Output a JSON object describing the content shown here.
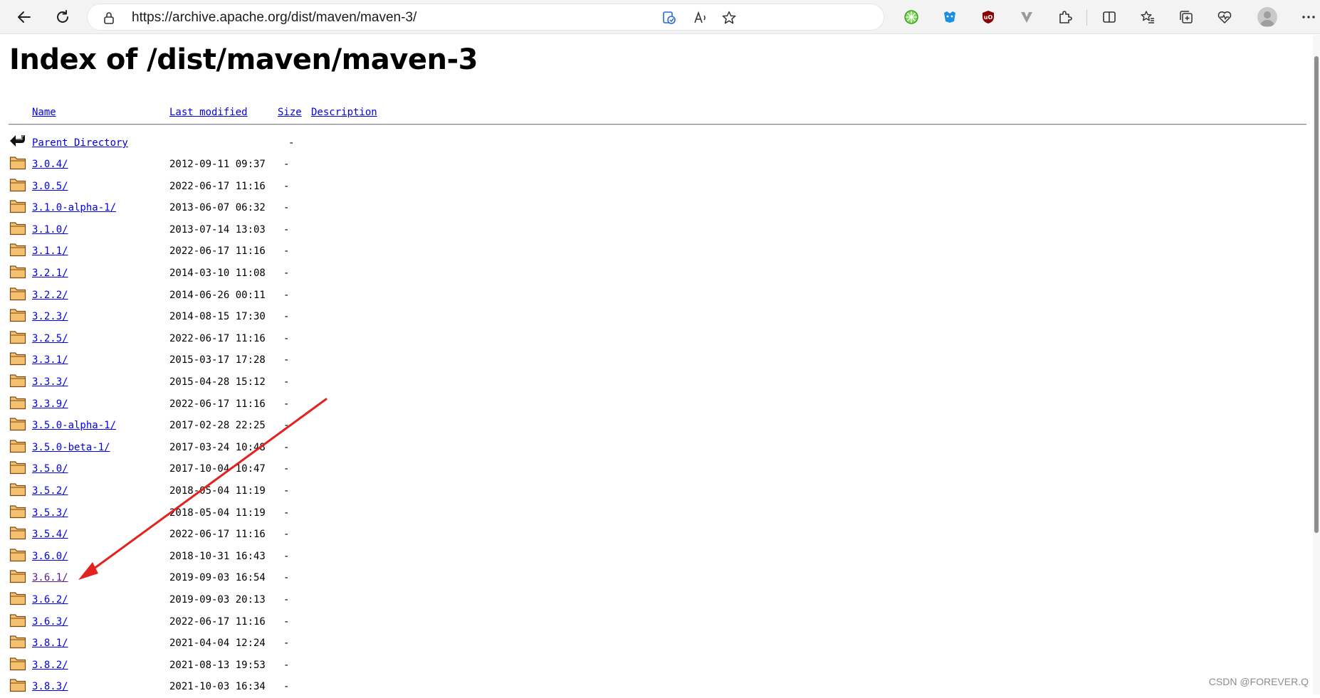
{
  "browser": {
    "url": "https://archive.apache.org/dist/maven/maven-3/",
    "icons": [
      "back-icon",
      "refresh-icon",
      "lock-icon",
      "app-available-icon",
      "read-aloud-icon",
      "favorite-star-icon",
      "extension-green-icon",
      "extension-blue-icon",
      "ublock-icon",
      "extension-v-icon",
      "extensions-puzzle-icon",
      "split-screen-icon",
      "favorites-list-icon",
      "collections-icon",
      "browser-essentials-icon",
      "profile-avatar",
      "more-menu-icon"
    ]
  },
  "page": {
    "title": "Index of /dist/maven/maven-3",
    "columns": {
      "name": "Name",
      "last_modified": "Last modified",
      "size": "Size",
      "description": "Description"
    },
    "parent": {
      "name": "Parent Directory",
      "size": "-"
    },
    "entries": [
      {
        "name": "3.0.4/",
        "modified": "2012-09-11 09:37",
        "size": "-"
      },
      {
        "name": "3.0.5/",
        "modified": "2022-06-17 11:16",
        "size": "-"
      },
      {
        "name": "3.1.0-alpha-1/",
        "modified": "2013-06-07 06:32",
        "size": "-"
      },
      {
        "name": "3.1.0/",
        "modified": "2013-07-14 13:03",
        "size": "-"
      },
      {
        "name": "3.1.1/",
        "modified": "2022-06-17 11:16",
        "size": "-"
      },
      {
        "name": "3.2.1/",
        "modified": "2014-03-10 11:08",
        "size": "-"
      },
      {
        "name": "3.2.2/",
        "modified": "2014-06-26 00:11",
        "size": "-"
      },
      {
        "name": "3.2.3/",
        "modified": "2014-08-15 17:30",
        "size": "-"
      },
      {
        "name": "3.2.5/",
        "modified": "2022-06-17 11:16",
        "size": "-"
      },
      {
        "name": "3.3.1/",
        "modified": "2015-03-17 17:28",
        "size": "-"
      },
      {
        "name": "3.3.3/",
        "modified": "2015-04-28 15:12",
        "size": "-"
      },
      {
        "name": "3.3.9/",
        "modified": "2022-06-17 11:16",
        "size": "-"
      },
      {
        "name": "3.5.0-alpha-1/",
        "modified": "2017-02-28 22:25",
        "size": "-"
      },
      {
        "name": "3.5.0-beta-1/",
        "modified": "2017-03-24 10:48",
        "size": "-"
      },
      {
        "name": "3.5.0/",
        "modified": "2017-10-04 10:47",
        "size": "-"
      },
      {
        "name": "3.5.2/",
        "modified": "2018-05-04 11:19",
        "size": "-"
      },
      {
        "name": "3.5.3/",
        "modified": "2018-05-04 11:19",
        "size": "-"
      },
      {
        "name": "3.5.4/",
        "modified": "2022-06-17 11:16",
        "size": "-"
      },
      {
        "name": "3.6.0/",
        "modified": "2018-10-31 16:43",
        "size": "-"
      },
      {
        "name": "3.6.1/",
        "modified": "2019-09-03 16:54",
        "size": "-",
        "visited": true
      },
      {
        "name": "3.6.2/",
        "modified": "2019-09-03 20:13",
        "size": "-"
      },
      {
        "name": "3.6.3/",
        "modified": "2022-06-17 11:16",
        "size": "-"
      },
      {
        "name": "3.8.1/",
        "modified": "2021-04-04 12:24",
        "size": "-"
      },
      {
        "name": "3.8.2/",
        "modified": "2021-08-13 19:53",
        "size": "-"
      },
      {
        "name": "3.8.3/",
        "modified": "2021-10-03 16:34",
        "size": "-"
      }
    ]
  },
  "colors": {
    "link": "#0000ee",
    "visited_link": "#551a8b",
    "folder_fill": "#f5c06f",
    "folder_outline": "#7a4a12",
    "annotation_arrow": "#e3211f"
  },
  "watermark": "CSDN @FOREVER.Q"
}
